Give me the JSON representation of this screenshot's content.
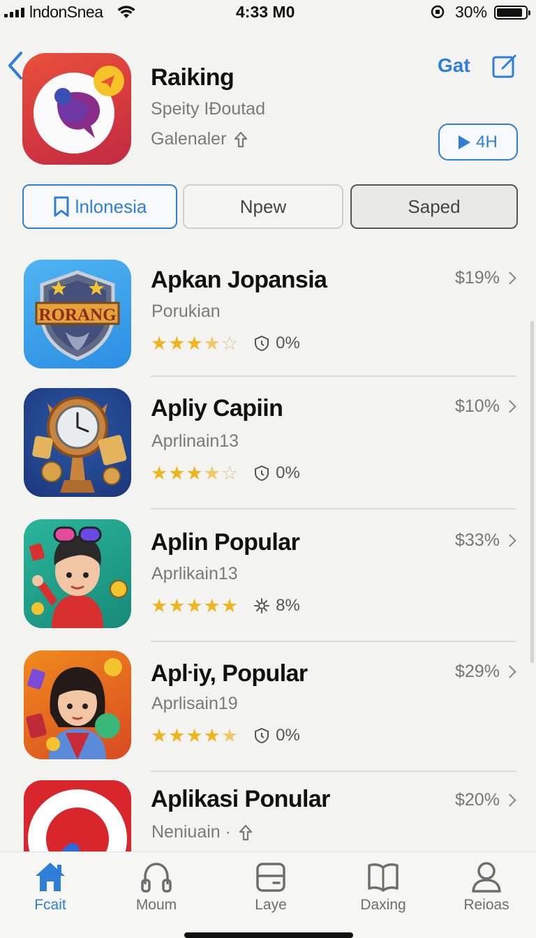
{
  "status_bar": {
    "carrier": "lndonSnea",
    "time": "4:33 M0",
    "battery_percent": "30%",
    "battery_level": 0.9
  },
  "header": {
    "title": "Raiking",
    "subtitle": "Speity IĐoutad",
    "category": "Galenaler",
    "get_label": "Gat",
    "play_label": "4H"
  },
  "tabs": [
    {
      "label": "lnlonesia",
      "state": "selected"
    },
    {
      "label": "Npew",
      "state": "default"
    },
    {
      "label": "Saped",
      "state": "pressed"
    }
  ],
  "apps": [
    {
      "title": "Apkan Jopansia",
      "subtitle": "Porukian",
      "rating": 3.5,
      "meta_icon": "shield-clock-icon",
      "meta": "0%",
      "price": "$19%",
      "icon_text": "RORANG"
    },
    {
      "title": "Apliy Capiin",
      "subtitle": "Aprlinain13",
      "rating": 3.5,
      "meta_icon": "shield-clock-icon",
      "meta": "0%",
      "price": "$10%"
    },
    {
      "title": "Aplin Popular",
      "subtitle": "Aprlikain13",
      "rating": 5,
      "meta_icon": "gear-icon",
      "meta": "8%",
      "price": "$33%"
    },
    {
      "title": "Apŀiy, Popular",
      "subtitle": "Aprlisain19",
      "rating": 4.5,
      "meta_icon": "shield-clock-icon",
      "meta": "0%",
      "price": "$29%"
    },
    {
      "title": "Aplikasi Ponular",
      "subtitle": "Neniuain ·",
      "price": "$20%"
    }
  ],
  "tab_bar": [
    {
      "label": "Fcait",
      "icon": "home-icon",
      "active": true
    },
    {
      "label": "Moum",
      "icon": "headphones-icon",
      "active": false
    },
    {
      "label": "Laye",
      "icon": "calendar-icon",
      "active": false
    },
    {
      "label": "Daxing",
      "icon": "book-icon",
      "active": false
    },
    {
      "label": "Reioas",
      "icon": "person-icon",
      "active": false
    }
  ],
  "colors": {
    "accent": "#2f7ed8",
    "star": "#f0b41c",
    "background": "#f3f3f2"
  }
}
